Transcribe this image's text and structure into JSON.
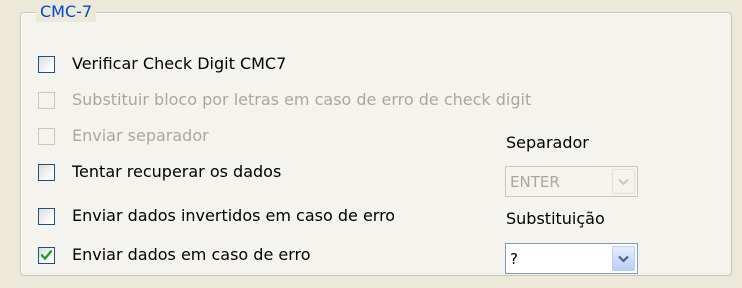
{
  "group": {
    "title": "CMC-7"
  },
  "options": [
    {
      "label": "Verificar Check Digit CMC7",
      "checked": false,
      "enabled": true
    },
    {
      "label": "Substituir bloco por letras em caso de erro de check digit",
      "checked": false,
      "enabled": false
    },
    {
      "label": "Enviar separador",
      "checked": false,
      "enabled": false
    },
    {
      "label": "Tentar recuperar os dados",
      "checked": false,
      "enabled": true
    },
    {
      "label": "Enviar dados invertidos em caso de erro",
      "checked": false,
      "enabled": true
    },
    {
      "label": "Enviar dados em caso de erro",
      "checked": true,
      "enabled": true
    }
  ],
  "separador": {
    "label": "Separador",
    "value": "ENTER",
    "enabled": false
  },
  "substituicao": {
    "label": "Substituição",
    "value": "?",
    "enabled": true
  },
  "colors": {
    "group_title": "#0046d5",
    "checkmark": "#21a121",
    "disabled_text": "#aca899",
    "dropdown_arrow": "#4d6185"
  },
  "icons": {
    "checkbox_check": "checkmark-icon",
    "dropdown": "chevron-down-icon"
  }
}
